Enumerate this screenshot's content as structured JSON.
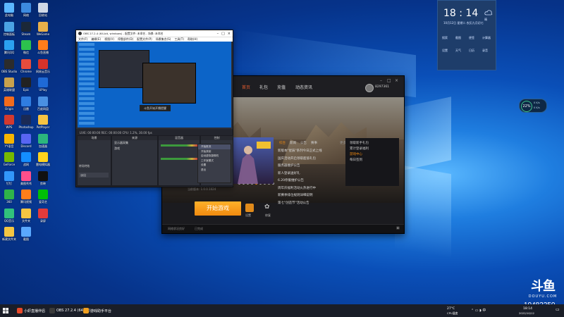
{
  "desktop_icons": [
    {
      "label": "此电脑",
      "color": "#5bb7ff"
    },
    {
      "label": "网络",
      "color": "#3d8be0"
    },
    {
      "label": "回收站",
      "color": "#cfd8e6"
    },
    {
      "label": "控制面板",
      "color": "#4ba3e3"
    },
    {
      "label": "Steam",
      "color": "#1b2838"
    },
    {
      "label": "WeGame",
      "color": "#e8b04a"
    },
    {
      "label": "腾讯QQ",
      "color": "#2ba0f0"
    },
    {
      "label": "微信",
      "color": "#2cc24d"
    },
    {
      "label": "斗鱼直播",
      "color": "#ff7d1a"
    },
    {
      "label": "OBS Studio",
      "color": "#2c2c2c"
    },
    {
      "label": "Chrome",
      "color": "#e74c3c"
    },
    {
      "label": "网易云音乐",
      "color": "#d7332b"
    },
    {
      "label": "英雄联盟",
      "color": "#c8a14d"
    },
    {
      "label": "Epic",
      "color": "#222222"
    },
    {
      "label": "UPlay",
      "color": "#1f6ad6"
    },
    {
      "label": "Origin",
      "color": "#f26b1c"
    },
    {
      "label": "迅雷",
      "color": "#2f7de1"
    },
    {
      "label": "百度网盘",
      "color": "#4a90e2"
    },
    {
      "label": "WPS",
      "color": "#d23a2f"
    },
    {
      "label": "Photoshop",
      "color": "#1a2a55"
    },
    {
      "label": "PotPlayer",
      "color": "#f6c342"
    },
    {
      "label": "YY语音",
      "color": "#f7b500"
    },
    {
      "label": "Discord",
      "color": "#5865f2"
    },
    {
      "label": "加速器",
      "color": "#2cb67d"
    },
    {
      "label": "GeForce",
      "color": "#76b900"
    },
    {
      "label": "战网",
      "color": "#148eff"
    },
    {
      "label": "雷电模拟器",
      "color": "#ffd21e"
    },
    {
      "label": "钉钉",
      "color": "#3296fa"
    },
    {
      "label": "美图秀秀",
      "color": "#ff4f8b"
    },
    {
      "label": "剪映",
      "color": "#111111"
    },
    {
      "label": "360",
      "color": "#2fb34a"
    },
    {
      "label": "腾讯视频",
      "color": "#ff7e1a"
    },
    {
      "label": "爱奇艺",
      "color": "#00be06"
    },
    {
      "label": "QQ音乐",
      "color": "#31c27c"
    },
    {
      "label": "文件夹",
      "color": "#f4c542"
    },
    {
      "label": "录屏",
      "color": "#e23b3b"
    },
    {
      "label": "新建文件夹",
      "color": "#f4c542"
    },
    {
      "label": "截图",
      "color": "#5aa9ff"
    }
  ],
  "obs": {
    "title": "OBS 27.2.4 (64-bit, windows) - 配置文件: 未命名 - 场景: 未命名",
    "menu": [
      "文件(F)",
      "编辑(E)",
      "视图(V)",
      "停靠部件(D)",
      "配置文件(P)",
      "场景集合(S)",
      "工具(T)",
      "帮助(H)"
    ],
    "panels": {
      "scenes": "场景",
      "sources": "来源",
      "mixer": "混音器",
      "transitions": "转场特效",
      "controls": "控制"
    },
    "sources": [
      "显示器采集",
      "游戏"
    ],
    "controls": [
      "开始推流",
      "开始录制",
      "启动虚拟摄像机",
      "工作室模式",
      "设置",
      "退出"
    ],
    "transition_label": "淡出",
    "status": "LIVE: 00:00:00   REC: 00:00:00   CPU: 1.2%, 30.00 fps",
    "preview_toast": "斗鱼开始开播提醒"
  },
  "context_menu": {
    "items": [
      "开始推流",
      "开始录制",
      "启动虚拟摄像机",
      "工作室模式",
      "设置",
      "退出"
    ]
  },
  "launcher": {
    "nav": [
      "首页",
      "礼包",
      "充值",
      "动态资讯"
    ],
    "username": "8297361",
    "window_icons": [
      "min",
      "max",
      "close"
    ],
    "tabs": [
      "综合",
      "新闻",
      "公告",
      "赛事"
    ],
    "more": "更多",
    "news": [
      "新版本\"星辰\"系列今日正式上线",
      "国庆活动开启领取超值礼包",
      "服务器维护公告",
      "新人登录送好礼",
      "6.20停服维护公告",
      "周年庆福利活动火热进行中",
      "新赛季排位规则详细说明",
      "第七\"创造节\"活动公告"
    ],
    "side_menu": [
      "领取新手礼包",
      "累计登录福利",
      "游戏中心",
      "每日签到"
    ],
    "start_label": "开始游戏",
    "version": "当前版本: 1.0.0.1024",
    "status_left": "网络状况良好",
    "status_right": "已完成",
    "bottom_icons": [
      "设置",
      "修复"
    ]
  },
  "clock": {
    "time": "18 : 14",
    "date": "10月12日 星期二  农历九月初七",
    "weather": "晴",
    "tiles": [
      "搜索",
      "截图",
      "便签",
      "计算器",
      "设置",
      "天气",
      "日历",
      "录音"
    ]
  },
  "network": {
    "percent": "22%",
    "up": "0 K/s",
    "down": "0 K/s"
  },
  "watermark": {
    "logo": "斗鱼",
    "sub": "DOUYU.COM",
    "room_id": "10483250"
  },
  "taskbar": {
    "apps": [
      {
        "label": "小虾直播伴侣",
        "color": "#e8492a"
      },
      {
        "label": "OBS 27.2.4 (64 bit)",
        "color": "#3a3a3a"
      },
      {
        "label": "游戏助手平台",
        "color": "#f0a020"
      }
    ],
    "tray_temp": "27°C",
    "tray_cpu": "CPU温度",
    "tray_time": "18:14",
    "tray_date": "2022/10/12"
  },
  "colors": {
    "accent": "#f08a10",
    "wallpaper": "#0a4fb8",
    "taskbar": "#1a1e28"
  }
}
